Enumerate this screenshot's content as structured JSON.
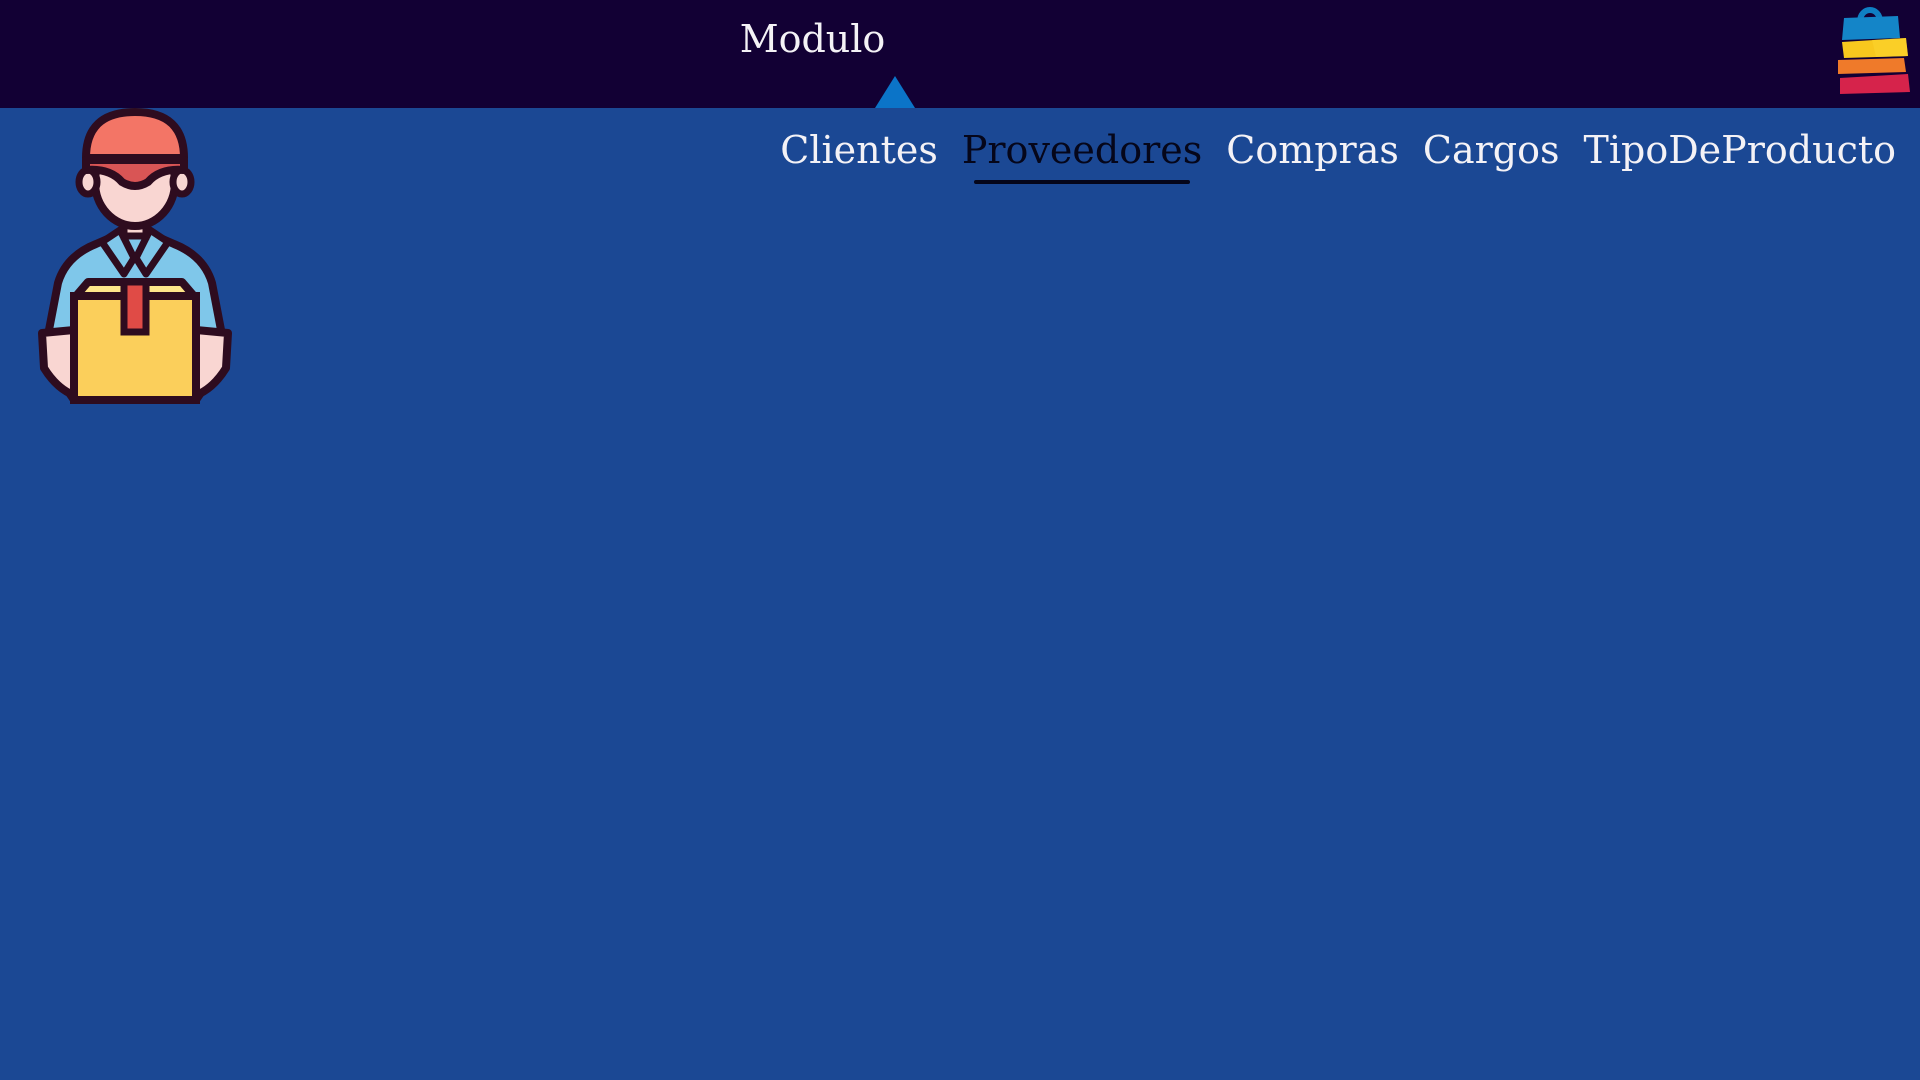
{
  "header": {
    "module_label": "Modulo",
    "logo_icon": "shopping-bag-icon",
    "caret_icon": "caret-up-icon"
  },
  "nav": {
    "items": [
      {
        "label": "Clientes",
        "active": false
      },
      {
        "label": "Proveedores",
        "active": true
      },
      {
        "label": "Compras",
        "active": false
      },
      {
        "label": "Cargos",
        "active": false
      },
      {
        "label": "TipoDeProducto",
        "active": false
      }
    ]
  },
  "illustration": {
    "icon": "delivery-person-icon"
  },
  "colors": {
    "topbar": "#120034",
    "background": "#1b4894",
    "caret": "#0b74c8",
    "active_nav": "#05061a",
    "nav_text": "#f4f2f6"
  }
}
